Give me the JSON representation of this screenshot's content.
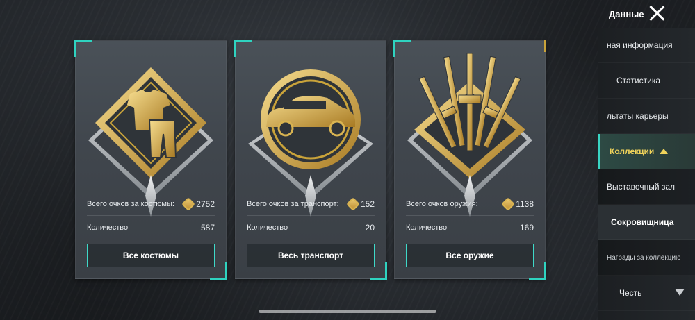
{
  "header": {
    "title": "Данные"
  },
  "cards": [
    {
      "points_label": "Всего очков за костюмы:",
      "points_value": "2752",
      "count_label": "Количество",
      "count_value": "587",
      "button_label": "Все костюмы"
    },
    {
      "points_label": "Всего очков за транспорт:",
      "points_value": "152",
      "count_label": "Количество",
      "count_value": "20",
      "button_label": "Весь транспорт"
    },
    {
      "points_label": "Всего очков оружия:",
      "points_value": "1138",
      "count_label": "Количество",
      "count_value": "169",
      "button_label": "Все оружие"
    }
  ],
  "sidebar": {
    "items": [
      {
        "label": "ная информация"
      },
      {
        "label": "Статистика"
      },
      {
        "label": "льтаты карьеры"
      },
      {
        "label": "Коллекции"
      },
      {
        "label": "Выставочный зал"
      },
      {
        "label": "Сокровищница"
      },
      {
        "label": "Награды за коллекцию"
      },
      {
        "label": "Честь"
      }
    ]
  },
  "colors": {
    "accent": "#3fd8c8",
    "gold": "#d9b451",
    "active_text": "#f0d35a"
  }
}
